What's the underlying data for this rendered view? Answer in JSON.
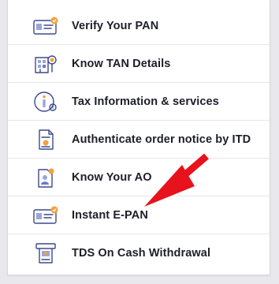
{
  "menu": {
    "items": [
      {
        "label": "Verify Your PAN",
        "icon": "pan-card-check-icon"
      },
      {
        "label": "Know TAN Details",
        "icon": "building-search-icon"
      },
      {
        "label": "Tax Information & services",
        "icon": "info-circle-icon"
      },
      {
        "label": "Authenticate order notice by ITD",
        "icon": "document-check-icon"
      },
      {
        "label": "Know Your AO",
        "icon": "id-badge-icon"
      },
      {
        "label": "Instant E-PAN",
        "icon": "e-pan-card-icon"
      },
      {
        "label": "TDS On Cash Withdrawal",
        "icon": "atm-cash-icon"
      }
    ]
  },
  "colors": {
    "arrow": "#e8121c",
    "icon_outline": "#3c4a8c",
    "icon_accent": "#f3a03a"
  }
}
